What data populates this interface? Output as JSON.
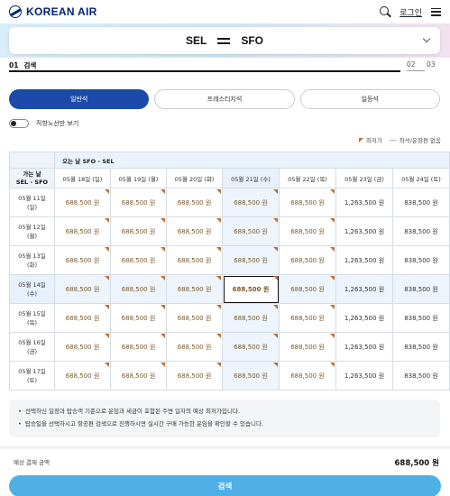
{
  "header": {
    "logo_text": "KOREAN AIR",
    "login_label": "로그인"
  },
  "route": {
    "origin": "SEL",
    "destination": "SFO"
  },
  "steps": [
    {
      "num": "01",
      "label": "검색"
    },
    {
      "num": "02"
    },
    {
      "num": "03"
    }
  ],
  "cabin_tabs": [
    "일반석",
    "프레스티지석",
    "일등석"
  ],
  "nonstop_toggle": {
    "label": "직항노선만 보기"
  },
  "legend": {
    "lowest": "최저가",
    "none": "좌석/운항편 없음"
  },
  "grid": {
    "banner": "오는 날 SFO - SEL",
    "corner_line1": "가는 날",
    "corner_line2": "SEL - SFO",
    "return_dates": [
      "05월 18일 (일)",
      "05월 19일 (월)",
      "05월 20일 (화)",
      "05월 21일 (수)",
      "05월 22일 (목)",
      "05월 23일 (금)",
      "05월 24일 (토)"
    ],
    "rows": [
      {
        "d1": "05월 11일",
        "d2": "(일)",
        "prices": [
          "688,500 원",
          "688,500 원",
          "688,500 원",
          "688,500 원",
          "688,500 원",
          "1,263,500 원",
          "838,500 원"
        ]
      },
      {
        "d1": "05월 12일",
        "d2": "(월)",
        "prices": [
          "688,500 원",
          "688,500 원",
          "688,500 원",
          "688,500 원",
          "688,500 원",
          "1,263,500 원",
          "838,500 원"
        ]
      },
      {
        "d1": "05월 13일",
        "d2": "(화)",
        "prices": [
          "688,500 원",
          "688,500 원",
          "688,500 원",
          "688,500 원",
          "688,500 원",
          "1,263,500 원",
          "838,500 원"
        ]
      },
      {
        "d1": "05월 14일",
        "d2": "(수)",
        "prices": [
          "688,500 원",
          "688,500 원",
          "688,500 원",
          "688,500 원",
          "688,500 원",
          "1,263,500 원",
          "838,500 원"
        ]
      },
      {
        "d1": "05월 15일",
        "d2": "(목)",
        "prices": [
          "688,500 원",
          "688,500 원",
          "688,500 원",
          "688,500 원",
          "688,500 원",
          "1,263,500 원",
          "838,500 원"
        ]
      },
      {
        "d1": "05월 16일",
        "d2": "(금)",
        "prices": [
          "688,500 원",
          "688,500 원",
          "688,500 원",
          "688,500 원",
          "688,500 원",
          "1,263,500 원",
          "838,500 원"
        ]
      },
      {
        "d1": "05월 17일",
        "d2": "(토)",
        "prices": [
          "688,500 원",
          "688,500 원",
          "688,500 원",
          "688,500 원",
          "688,500 원",
          "1,263,500 원",
          "838,500 원"
        ]
      }
    ]
  },
  "notices": [
    "선택하신 일정과 탑승객 기준으로 운임과 세금이 포함된 주변 일자의 예상 최저가입니다.",
    "탑승일을 선택하시고 항공편 검색으로 진행하시면 실시간 구매 가능한 운임을 확인할 수 있습니다."
  ],
  "footer": {
    "total_label": "예상 결제 금액",
    "total_value": "688,500 원",
    "search_label": "검색"
  },
  "colors": {
    "accent": "#1c4aa8",
    "search_button": "#4fb0e6",
    "lowest_marker": "#b87333",
    "brand": "#00256c"
  }
}
